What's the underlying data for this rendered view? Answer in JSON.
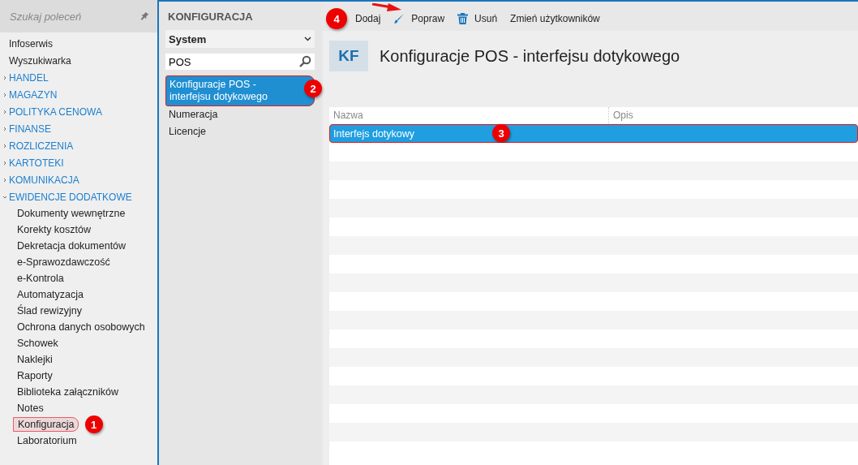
{
  "sidebar": {
    "search": {
      "placeholder": "Szukaj poleceń"
    },
    "items": [
      {
        "label": "Infoserwis",
        "kind": "link"
      },
      {
        "label": "Wyszukiwarka",
        "kind": "link"
      },
      {
        "label": "HANDEL",
        "kind": "group",
        "expanded": false
      },
      {
        "label": "MAGAZYN",
        "kind": "group",
        "expanded": false
      },
      {
        "label": "POLITYKA CENOWA",
        "kind": "group",
        "expanded": false
      },
      {
        "label": "FINANSE",
        "kind": "group",
        "expanded": false
      },
      {
        "label": "ROZLICZENIA",
        "kind": "group",
        "expanded": false
      },
      {
        "label": "KARTOTEKI",
        "kind": "group",
        "expanded": false
      },
      {
        "label": "KOMUNIKACJA",
        "kind": "group",
        "expanded": false
      },
      {
        "label": "EWIDENCJE DODATKOWE",
        "kind": "group",
        "expanded": true,
        "children": [
          {
            "label": "Dokumenty wewnętrzne",
            "selected": false
          },
          {
            "label": "Korekty kosztów",
            "selected": false
          },
          {
            "label": "Dekretacja dokumentów",
            "selected": false
          },
          {
            "label": "e-Sprawozdawczość",
            "selected": false
          },
          {
            "label": "e-Kontrola",
            "selected": false
          },
          {
            "label": "Automatyzacja",
            "selected": false
          },
          {
            "label": "Ślad rewizyjny",
            "selected": false
          },
          {
            "label": "Ochrona danych osobowych",
            "selected": false
          },
          {
            "label": "Schowek",
            "selected": false
          },
          {
            "label": "Naklejki",
            "selected": false
          },
          {
            "label": "Raporty",
            "selected": false
          },
          {
            "label": "Biblioteka załączników",
            "selected": false
          },
          {
            "label": "Notes",
            "selected": false
          },
          {
            "label": "Konfiguracja",
            "selected": true,
            "marker": "1"
          },
          {
            "label": "Laboratorium",
            "selected": false
          }
        ]
      }
    ]
  },
  "config_panel": {
    "title": "KONFIGURACJA",
    "dropdown": {
      "value": "System"
    },
    "search": {
      "value": "POS"
    },
    "items": [
      {
        "label": "Konfiguracje POS - interfejsu dotykowego",
        "selected": true,
        "marker": "2"
      },
      {
        "label": "Numeracja",
        "selected": false
      },
      {
        "label": "Licencje",
        "selected": false
      }
    ]
  },
  "toolbar": {
    "buttons": [
      {
        "label": "Dodaj",
        "kind": "plain",
        "marker": "4"
      },
      {
        "label": "Popraw",
        "kind": "edit",
        "arrow": true
      },
      {
        "label": "Usuń",
        "kind": "delete"
      },
      {
        "label": "Zmień użytkowników",
        "kind": "plain"
      }
    ]
  },
  "header": {
    "badge": "KF",
    "title": "Konfiguracje POS - interfejsu dotykowego"
  },
  "table": {
    "columns": [
      "Nazwa",
      "Opis"
    ],
    "rows": [
      {
        "nazwa": "Interfejs dotykowy",
        "selected": true,
        "marker": "3"
      }
    ]
  }
}
